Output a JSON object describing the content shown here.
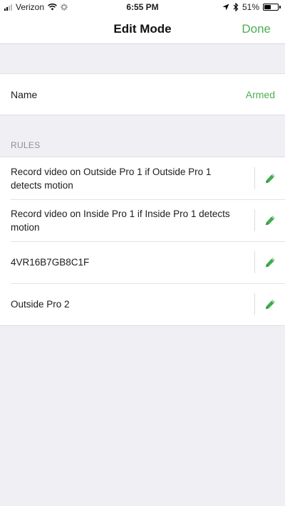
{
  "status_bar": {
    "carrier": "Verizon",
    "time": "6:55 PM",
    "battery_percent": "51%",
    "battery_level": 0.51
  },
  "nav": {
    "title": "Edit Mode",
    "done_label": "Done"
  },
  "name_row": {
    "label": "Name",
    "value": "Armed"
  },
  "rules_section": {
    "header": "RULES",
    "items": [
      {
        "text": "Record video on Outside Pro 1 if Outside Pro 1 detects motion"
      },
      {
        "text": "Record video on Inside Pro 1 if Inside Pro 1 detects motion"
      },
      {
        "text": "4VR16B7GB8C1F"
      },
      {
        "text": "Outside Pro 2"
      }
    ]
  },
  "colors": {
    "accent": "#4caf50",
    "background": "#efeff4",
    "section_header": "#8e8e93"
  },
  "icons": {
    "edit": "pencil-icon",
    "wifi": "wifi-icon",
    "activity": "loading-spinner-icon",
    "location": "location-arrow-icon",
    "bluetooth": "bluetooth-icon",
    "battery": "battery-icon",
    "signal": "signal-bars-icon"
  }
}
